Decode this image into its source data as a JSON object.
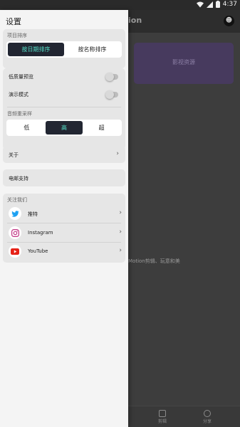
{
  "status_bar": {
    "time": "4:37"
  },
  "background_app": {
    "logo_text": "ion",
    "user_icon": "user-avatar-icon",
    "card_label": "影视资源",
    "body_text": "Motion剪辑、玩意和美",
    "tabs": [
      {
        "label": "剪辑",
        "icon": "edit-icon"
      },
      {
        "label": "分享",
        "icon": "share-icon"
      }
    ]
  },
  "drawer": {
    "title": "设置",
    "sort": {
      "label": "项目排序",
      "options": [
        "按日期排序",
        "按名称排序"
      ],
      "selected": "按日期排序"
    },
    "toggles": [
      {
        "label": "低质量预览",
        "on": false
      },
      {
        "label": "演示模式",
        "on": false
      }
    ],
    "resample": {
      "label": "音频重采样",
      "options": [
        "低",
        "高",
        "超"
      ],
      "selected": "高"
    },
    "about": {
      "label": "关于"
    },
    "email_support": {
      "label": "电邮支持"
    },
    "follow_us": {
      "label": "关注我们",
      "items": [
        {
          "label": "推特",
          "icon": "twitter-icon",
          "color": "#1DA1F2"
        },
        {
          "label": "Instagram",
          "icon": "instagram-icon",
          "color": "#C13584"
        },
        {
          "label": "YouTube",
          "icon": "youtube-icon",
          "color": "#E62117"
        }
      ]
    }
  },
  "colors": {
    "accent_text": "#55E0C8",
    "selected_segment_bg": "#222632",
    "drawer_bg": "#F4F4F4",
    "group_bg": "#E6E6E6"
  }
}
